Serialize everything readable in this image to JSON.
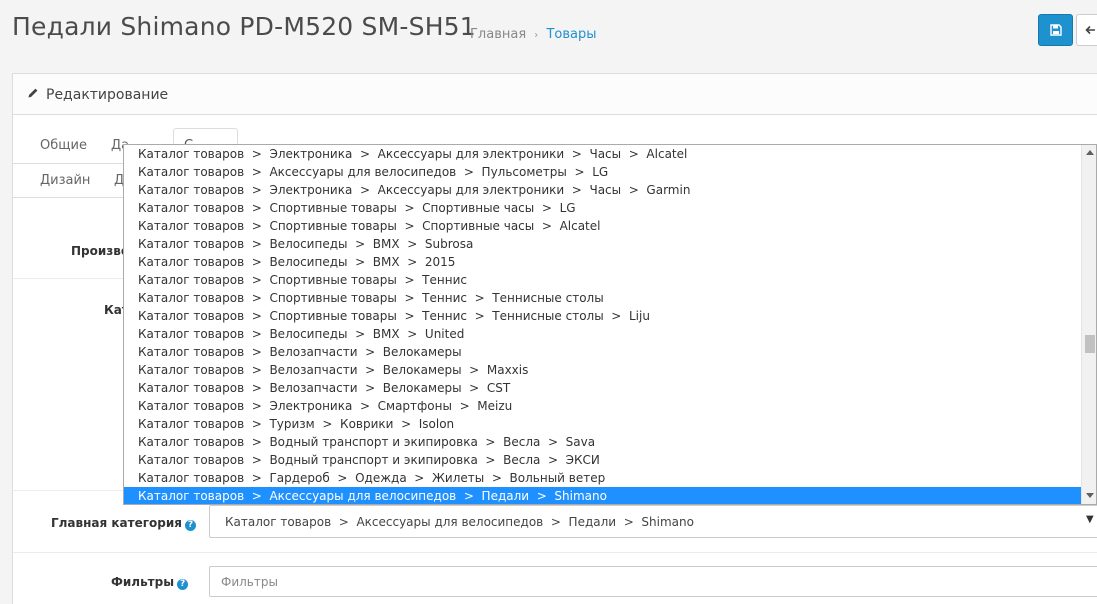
{
  "header": {
    "title": "Педали Shimano PD-M520 SM-SH51",
    "breadcrumb": {
      "home": "Главная",
      "separator": "›",
      "current": "Товары"
    },
    "save_icon": "floppy-disk-icon",
    "back_icon": "arrow-left-icon"
  },
  "panel": {
    "title": "Редактирование",
    "title_icon": "pencil-icon"
  },
  "tabs": {
    "row1": [
      "Общие",
      "Да",
      "С"
    ],
    "row2": [
      "Дизайн",
      "Д"
    ]
  },
  "labels": {
    "manufacturer": "Произво",
    "categories": "Кат",
    "main_category": "Главная категория",
    "filters": "Фильтры",
    "help_glyph": "?"
  },
  "main_category": {
    "value": "Каталог товаров  >  Аксессуары для велосипедов  >  Педали  >  Shimano",
    "caret": "▼"
  },
  "filters_input": {
    "placeholder": "Фильтры"
  },
  "dropdown": {
    "options": [
      "Каталог товаров  >  Электроника  >  Аксессуары для электроники  >  Часы  >  Alcatel",
      "Каталог товаров  >  Аксессуары для велосипедов  >  Пульсометры  >  LG",
      "Каталог товаров  >  Электроника  >  Аксессуары для электроники  >  Часы  >  Garmin",
      "Каталог товаров  >  Спортивные товары  >  Спортивные часы  >  LG",
      "Каталог товаров  >  Спортивные товары  >  Спортивные часы  >  Alcatel",
      "Каталог товаров  >  Велосипеды  >  BMX  >  Subrosa",
      "Каталог товаров  >  Велосипеды  >  BMX  >  2015",
      "Каталог товаров  >  Спортивные товары  >  Теннис",
      "Каталог товаров  >  Спортивные товары  >  Теннис  >  Теннисные столы",
      "Каталог товаров  >  Спортивные товары  >  Теннис  >  Теннисные столы  >  Liju",
      "Каталог товаров  >  Велосипеды  >  BMX  >  United",
      "Каталог товаров  >  Велозапчасти  >  Велокамеры",
      "Каталог товаров  >  Велозапчасти  >  Велокамеры  >  Maxxis",
      "Каталог товаров  >  Велозапчасти  >  Велокамеры  >  CST",
      "Каталог товаров  >  Электроника  >  Смартфоны  >  Meizu",
      "Каталог товаров  >  Туризм  >  Коврики  >  Isolon",
      "Каталог товаров  >  Водный транспорт и экипировка  >  Весла  >  Sava",
      "Каталог товаров  >  Водный транспорт и экипировка  >  Весла  >  ЭКСИ",
      "Каталог товаров  >  Гардероб  >  Одежда  >  Жилеты  >  Вольный ветер",
      "Каталог товаров  >  Аксессуары для велосипедов  >  Педали  >  Shimano"
    ],
    "selected_index": 19
  }
}
